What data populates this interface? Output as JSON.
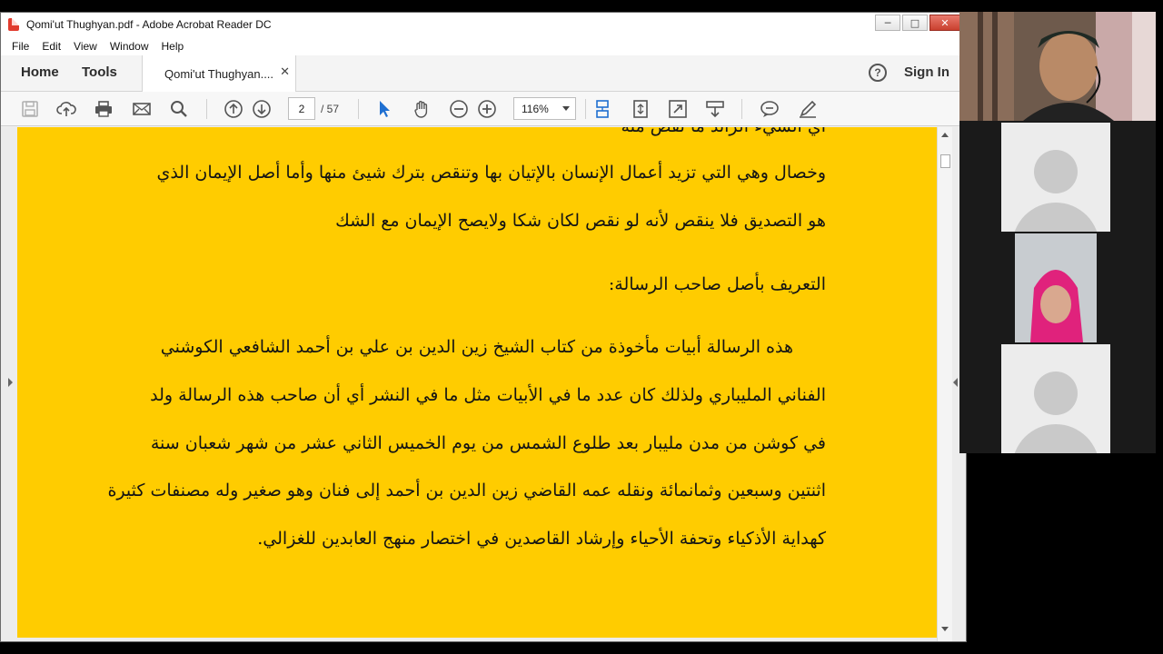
{
  "window": {
    "title": "Qomi'ut Thughyan.pdf - Adobe Acrobat Reader DC",
    "minimize_glyph": "─",
    "maximize_glyph": "□",
    "close_glyph": "✕"
  },
  "menu": [
    "File",
    "Edit",
    "View",
    "Window",
    "Help"
  ],
  "tabs": {
    "home": "Home",
    "tools": "Tools",
    "document": "Qomi'ut Thughyan....",
    "close_glyph": "✕"
  },
  "account": {
    "help_glyph": "?",
    "sign_in": "Sign In"
  },
  "toolbar": {
    "current_page": "2",
    "total_pages": "/ 57",
    "zoom": "116%",
    "icons": [
      "save-icon",
      "cloud-upload-icon",
      "print-icon",
      "email-icon",
      "search-icon",
      "page-up-icon",
      "page-down-icon",
      "select-cursor-icon",
      "hand-icon",
      "zoom-out-icon",
      "zoom-in-icon",
      "scroll-mode-icon",
      "fit-page-icon",
      "fullscreen-icon",
      "download-icon",
      "comment-icon",
      "pen-icon"
    ]
  },
  "document": {
    "background": "#ffcc00",
    "lines": [
      "أي الشيء الزائد ما نقص منه",
      "وخصال وهي التي تزيد أعمال الإنسان بالإتيان بها وتنقص بترك شيئ منها وأما أصل الإيمان الذي",
      "هو التصديق فلا ينقص لأنه لو نقص لكان شكا ولايصح الإيمان مع الشك",
      "التعريف بأصل صاحب الرسالة:",
      "هذه الرسالة أبيات مأخوذة من كتاب الشيخ زين الدين بن علي بن أحمد الشافعي الكوشني",
      "الفناني المليباري ولذلك كان عدد ما في الأبيات مثل ما في النشر أي أن صاحب هذه الرسالة ولد",
      "في كوشن من مدن مليبار بعد طلوع الشمس من يوم الخميس الثاني عشر من شهر شعبان سنة",
      "اثنتين وسبعين وثمانمائة ونقله عمه القاضي زين الدين بن أحمد إلى فنان وهو صغير وله مصنفات كثيرة",
      "كهداية الأذكياء وتحفة الأحياء وإرشاد القاصدين في اختصار منهج العابدين للغزالي."
    ]
  },
  "participants": [
    "video-participant-1",
    "avatar-participant-2",
    "video-participant-3",
    "avatar-participant-4"
  ]
}
